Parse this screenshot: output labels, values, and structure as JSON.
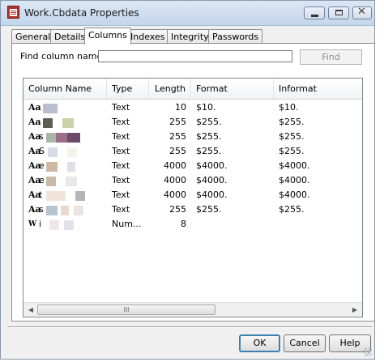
{
  "window": {
    "title": "Work.Cbdata Properties",
    "icon": "dataset-properties-icon",
    "controls": [
      "minimize",
      "maximize",
      "close"
    ]
  },
  "tabs": [
    {
      "label": "General",
      "active": false
    },
    {
      "label": "Details",
      "active": false
    },
    {
      "label": "Columns",
      "active": true
    },
    {
      "label": "Indexes",
      "active": false
    },
    {
      "label": "Integrity",
      "active": false
    },
    {
      "label": "Passwords",
      "active": false
    }
  ],
  "find": {
    "label": "Find column name:",
    "value": "",
    "button": "Find"
  },
  "columns_table": {
    "headers": [
      "Column Name",
      "Type",
      "Length",
      "Format",
      "Informat"
    ],
    "rows": [
      {
        "icon": "Aa",
        "name": "",
        "type": "Text",
        "length": "10",
        "format": "$10.",
        "informat": "$10."
      },
      {
        "icon": "Aa",
        "name": "",
        "type": "Text",
        "length": "255",
        "format": "$255.",
        "informat": "$255."
      },
      {
        "icon": "Aa",
        "name": "s",
        "type": "Text",
        "length": "255",
        "format": "$255.",
        "informat": "$255."
      },
      {
        "icon": "Aa",
        "name": "S",
        "type": "Text",
        "length": "255",
        "format": "$255.",
        "informat": "$255."
      },
      {
        "icon": "Aa",
        "name": "e",
        "type": "Text",
        "length": "4000",
        "format": "$4000.",
        "informat": "$4000."
      },
      {
        "icon": "Aa",
        "name": "e",
        "type": "Text",
        "length": "4000",
        "format": "$4000.",
        "informat": "$4000."
      },
      {
        "icon": "Aa",
        "name": "t",
        "type": "Text",
        "length": "4000",
        "format": "$4000.",
        "informat": "$4000."
      },
      {
        "icon": "Aa",
        "name": "s",
        "type": "Text",
        "length": "255",
        "format": "$255.",
        "informat": "$255."
      },
      {
        "icon": "W",
        "name": "i",
        "type": "Num...",
        "length": "8",
        "format": "",
        "informat": ""
      }
    ]
  },
  "scrollbar": {
    "thumb_label": "III"
  },
  "buttons": {
    "ok": "OK",
    "cancel": "Cancel",
    "help": "Help"
  },
  "colors": {
    "title_bar": "#c4d6ec",
    "app_icon": "#b3342e",
    "default_button_border": "#3c7fb1"
  }
}
